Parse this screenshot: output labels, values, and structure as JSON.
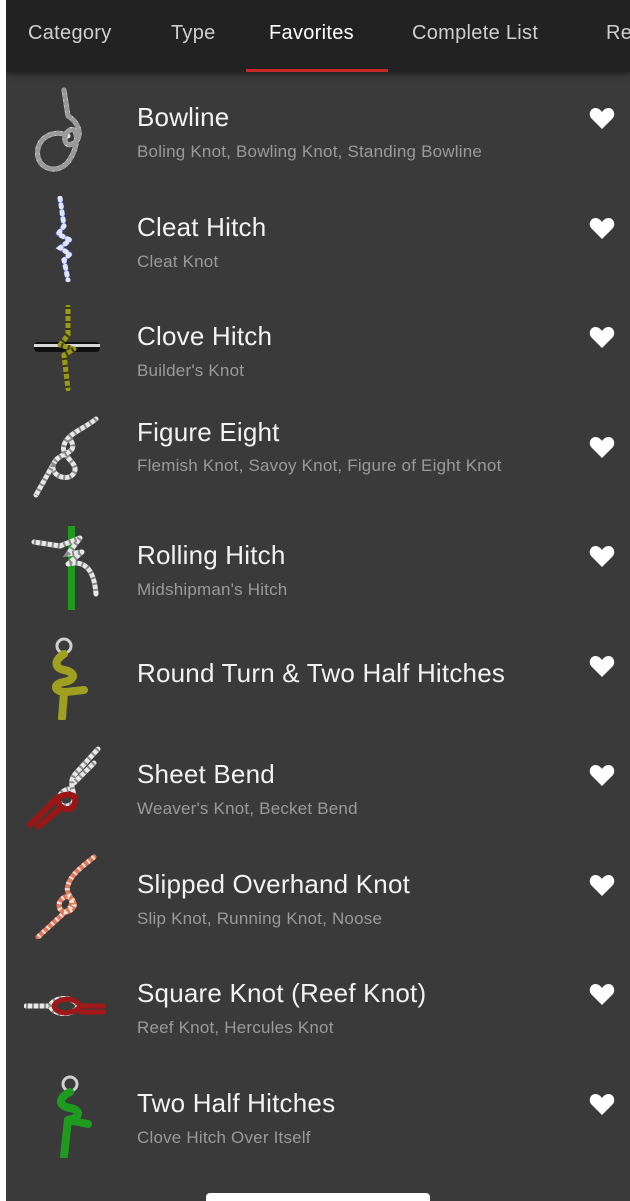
{
  "tabs": [
    {
      "label": "Category"
    },
    {
      "label": "Type"
    },
    {
      "label": "Favorites"
    },
    {
      "label": "Complete List"
    },
    {
      "label": "Re"
    }
  ],
  "active_tab": "Favorites",
  "accent_color": "#c62828",
  "knots": [
    {
      "title": "Bowline",
      "subtitle": "Boling Knot, Bowling Knot, Standing Bowline",
      "icon": "bowline-knot-icon",
      "favorite": true
    },
    {
      "title": "Cleat Hitch",
      "subtitle": "Cleat Knot",
      "icon": "cleat-hitch-icon",
      "favorite": true
    },
    {
      "title": "Clove Hitch",
      "subtitle": "Builder's Knot",
      "icon": "clove-hitch-icon",
      "favorite": true
    },
    {
      "title": "Figure Eight",
      "subtitle": "Flemish Knot, Savoy Knot, Figure of Eight Knot",
      "icon": "figure-eight-icon",
      "favorite": true
    },
    {
      "title": "Rolling Hitch",
      "subtitle": "Midshipman's Hitch",
      "icon": "rolling-hitch-icon",
      "favorite": true
    },
    {
      "title": "Round Turn & Two Half Hitches",
      "subtitle": "",
      "icon": "round-turn-icon",
      "favorite": true
    },
    {
      "title": "Sheet Bend",
      "subtitle": "Weaver's Knot, Becket Bend",
      "icon": "sheet-bend-icon",
      "favorite": true
    },
    {
      "title": "Slipped Overhand Knot",
      "subtitle": "Slip Knot, Running Knot, Noose",
      "icon": "slipped-overhand-icon",
      "favorite": true
    },
    {
      "title": "Square Knot (Reef Knot)",
      "subtitle": "Reef Knot, Hercules Knot",
      "icon": "square-knot-icon",
      "favorite": true
    },
    {
      "title": "Two Half Hitches",
      "subtitle": "Clove Hitch Over Itself",
      "icon": "two-half-hitches-icon",
      "favorite": true
    }
  ]
}
